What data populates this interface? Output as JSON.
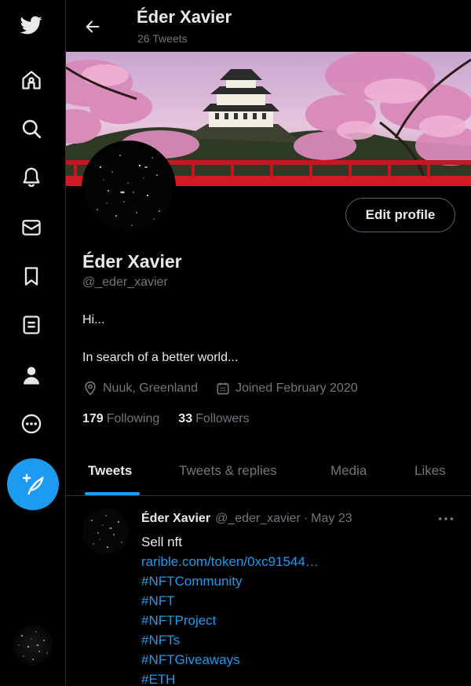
{
  "sidebar": {
    "icons": [
      "twitter-logo-icon",
      "home-icon",
      "explore-search-icon",
      "notifications-bell-icon",
      "messages-envelope-icon",
      "bookmarks-icon",
      "lists-icon",
      "profile-person-icon",
      "more-circle-icon"
    ],
    "compose_icon": "compose-feather-plus-icon"
  },
  "header": {
    "name": "Éder Xavier",
    "tweet_count": "26 Tweets"
  },
  "profile": {
    "edit_button": "Edit profile",
    "display_name": "Éder Xavier",
    "handle": "@_eder_xavier",
    "bio_line1": "Hi...",
    "bio_line2": "In search of a better world...",
    "location": "Nuuk, Greenland",
    "joined": "Joined February 2020",
    "following_count": "179",
    "following_label": "Following",
    "followers_count": "33",
    "followers_label": "Followers"
  },
  "tabs": {
    "active": "Tweets",
    "items": [
      "Tweets",
      "Tweets & replies",
      "Media",
      "Likes"
    ]
  },
  "tweet": {
    "name": "Éder Xavier",
    "handle": "@_eder_xavier",
    "separator": "·",
    "date": "May 23",
    "text": "Sell nft",
    "link": "rarible.com/token/0xc91544…",
    "hashtags": [
      "#NFTCommunity",
      "#NFT",
      "#NFTProject",
      "#NFTs",
      "#NFTGiveaways",
      "#ETH"
    ]
  },
  "colors": {
    "accent": "#1d9bf0",
    "background": "#000000",
    "text_primary": "#e7e9ea",
    "text_secondary": "#71767b",
    "border": "#2f3336"
  }
}
